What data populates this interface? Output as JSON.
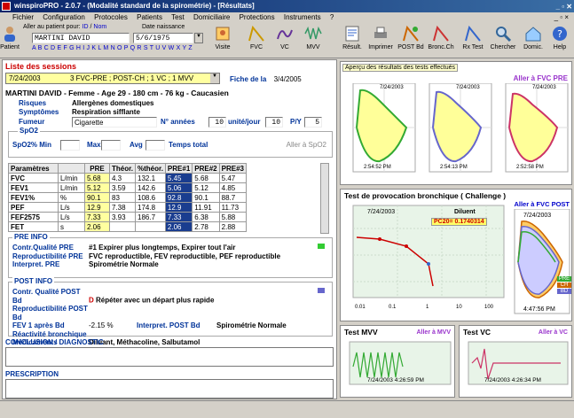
{
  "window": {
    "title": "winspiroPRO - 2.0.7 - (Modalité standard de la spirométrie) - [Résultats]"
  },
  "menu": [
    "Fichier",
    "Configuration",
    "Protocoles",
    "Patients",
    "Test",
    "Domiciliaire",
    "Protections",
    "Instruments",
    "?"
  ],
  "toolbar": {
    "patient_label": "Patient",
    "goto_label": "Aller au patient pour:",
    "id_label": "ID",
    "name_label": "Nom",
    "dob_label": "Date naissance",
    "patient_name": "MARTINI DAVID",
    "dob": "5/6/1975",
    "alphabet": "A B C D E F G H I J K L M N O P Q R S T U V W X Y Z",
    "buttons": [
      "Visite",
      "FVC",
      "VC",
      "MVV",
      "Résult.",
      "Imprimer",
      "POST Bd",
      "Bronc.Ch",
      "Rx Test",
      "Chercher",
      "Domic.",
      "Help"
    ]
  },
  "sessions": {
    "title": "Liste des sessions",
    "date": "7/24/2003",
    "desc": "3 FVC-PRE ; POST-CH ; 1 VC ; 1 MVV",
    "fiche_label": "Fiche de la",
    "fiche_date": "3/4/2005"
  },
  "patient": {
    "header": "MARTINI DAVID - Femme - Age 29 - 180 cm - 76 kg - Caucasien",
    "risques_label": "Risques",
    "risques": "Allergènes domestiques",
    "symptomes_label": "Symptômes",
    "symptomes": "Respiration sifflante",
    "fumeur_label": "Fumeur",
    "fumeur": "Cigarette",
    "annees_label": "N° années",
    "annees": "10",
    "unite_label": "unité/jour",
    "unite": "10",
    "py_label": "P/Y",
    "py": "5"
  },
  "spo2": {
    "title": "SpO2",
    "min_label": "SpO2% Min",
    "max_label": "Max",
    "avg_label": "Avg",
    "temps_label": "Temps total",
    "goto": "Aller à SpO2"
  },
  "params": {
    "headers": [
      "Paramètres",
      "",
      "PRE",
      "Théor.",
      "%théor.",
      "PRE#1",
      "PRE#2",
      "PRE#3"
    ],
    "rows": [
      [
        "FVC",
        "L/min",
        "5.68",
        "4.3",
        "132.1",
        "5.45",
        "5.68",
        "5.47"
      ],
      [
        "FEV1",
        "L/min",
        "5.12",
        "3.59",
        "142.6",
        "5.06",
        "5.12",
        "4.85"
      ],
      [
        "FEV1%",
        "%",
        "90.1",
        "83",
        "108.6",
        "92.8",
        "90.1",
        "88.7"
      ],
      [
        "PEF",
        "L/s",
        "12.9",
        "7.38",
        "174.8",
        "12.9",
        "11.91",
        "11.73"
      ],
      [
        "FEF2575",
        "L/s",
        "7.33",
        "3.93",
        "186.7",
        "7.33",
        "6.38",
        "5.88"
      ],
      [
        "FET",
        "s",
        "2.06",
        "",
        "",
        "2.06",
        "2.78",
        "2.88"
      ]
    ]
  },
  "pre_info": {
    "title": "PRE INFO",
    "qual_label": "Contr.Qualité PRE",
    "qual": "#1 Expirer plus longtemps, Expirer tout l'air",
    "repro_label": "Reproductibilité PRE",
    "repro": "FVC reproductible, FEV reproductible, PEF reproductible",
    "interp_label": "Interpret. PRE",
    "interp": "Spirométrie Normale"
  },
  "post_info": {
    "title": "POST INFO",
    "qual_label": "Contr. Qualité POST Bd",
    "qual_flag": "D",
    "qual": "Répéter avec un départ plus rapide",
    "repro_label": "Reproductibilité POST Bd",
    "fev_label": "FEV 1 après Bd",
    "fev": "-2.15 %",
    "interp_label": "Interpret. POST Bd",
    "interp": "Spirométrie Normale",
    "reac_label": "Réactivité bronchique",
    "med_label": "Médicaments",
    "med": "Diluant, Méthacoline, Salbutamol"
  },
  "conclusion_label": "CONCLUSION / DIAGNOSTIC",
  "prescription_label": "PRESCRIPTION",
  "right": {
    "preview_title": "Aperçu des résultats des tests effectués",
    "goto_fvc_pre": "Aller à FVC PRE",
    "loops": [
      {
        "date": "7/24/2003",
        "time": "2:54:52 PM"
      },
      {
        "date": "7/24/2003",
        "time": "2:54:13 PM"
      },
      {
        "date": "7/24/2003",
        "time": "2:52:58 PM"
      }
    ],
    "challenge_title": "Test de provocation bronchique   ( Challenge )",
    "goto_fvc_post": "Aller à FVC POST",
    "challenge_date": "7/24/2003",
    "diluent": "Diluent",
    "pc20": "PC20= 0.1740314",
    "post_date": "7/24/2003",
    "post_time": "4:47:56 PM",
    "legend": [
      "PRE",
      "CH",
      "BD"
    ],
    "mvv_title": "Test MVV",
    "goto_mvv": "Aller à MVV",
    "mvv_stamp": "7/24/2003 4:26:59 PM",
    "vc_title": "Test VC",
    "goto_vc": "Aller à VC",
    "vc_stamp": "7/24/2003 4:26:34 PM"
  },
  "colors": {
    "accent": "#0a246a",
    "red": "#cc0000",
    "yellow": "#ffffa0",
    "purple": "#9933cc"
  }
}
